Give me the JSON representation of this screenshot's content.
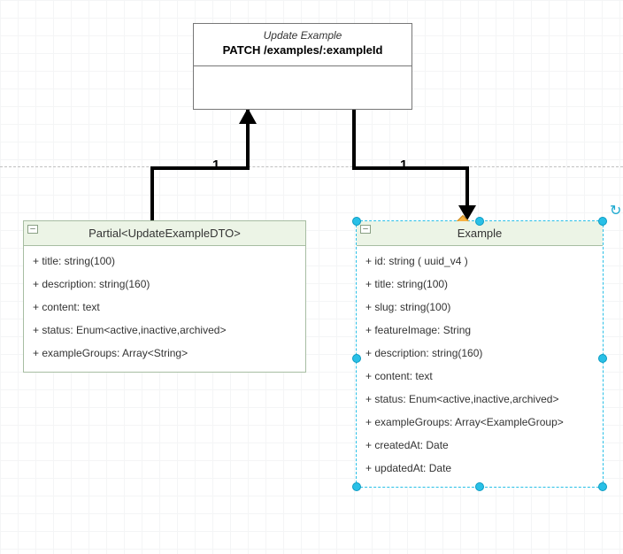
{
  "usecase": {
    "stereotype": "Update Example",
    "name": "PATCH /examples/:exampleId"
  },
  "edges": {
    "left": {
      "multiplicity": "1"
    },
    "right": {
      "multiplicity": "1"
    }
  },
  "dto": {
    "title": "Partial<UpdateExampleDTO>",
    "attrs": [
      "+ title: string(100)",
      "+ description: string(160)",
      "+ content: text",
      "+ status: Enum<active,inactive,archived>",
      "+ exampleGroups: Array<String>"
    ]
  },
  "example": {
    "title": "Example",
    "attrs": [
      "+ id: string ( uuid_v4 )",
      "+ title: string(100)",
      "+ slug: string(100)",
      "+ featureImage: String",
      "+ description: string(160)",
      "+ content: text",
      "+ status: Enum<active,inactive,archived>",
      "+ exampleGroups: Array<ExampleGroup>",
      "+ createdAt: Date",
      "+ updatedAt: Date"
    ]
  },
  "glyphs": {
    "collapse": "–",
    "rotate": "↻"
  }
}
